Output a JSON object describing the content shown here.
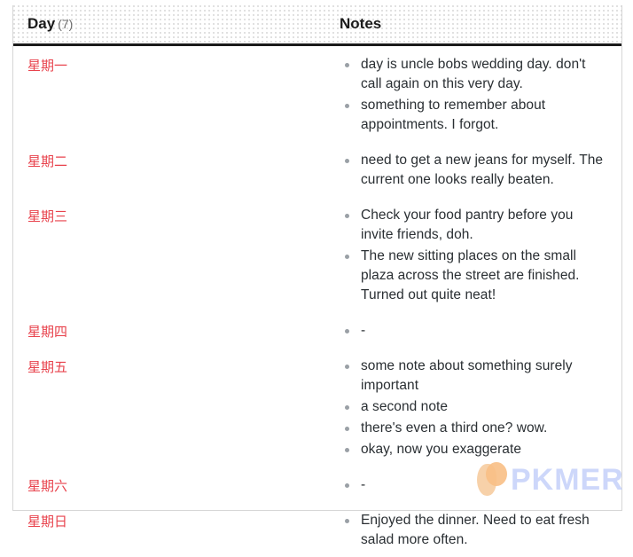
{
  "table": {
    "columns": [
      {
        "key": "day",
        "label": "Day",
        "count": "(7)"
      },
      {
        "key": "notes",
        "label": "Notes"
      }
    ],
    "rows": [
      {
        "day": "星期一",
        "notes": [
          "day is uncle bobs wedding day. don't call again on this very day.",
          "something to remember about appointments. I forgot."
        ]
      },
      {
        "day": "星期二",
        "notes": [
          "need to get a new jeans for myself. The current one looks really beaten."
        ]
      },
      {
        "day": "星期三",
        "notes": [
          "Check your food pantry before you invite friends, doh.",
          "The new sitting places on the small plaza across the street are finished. Turned out quite neat!"
        ]
      },
      {
        "day": "星期四",
        "notes": [
          "-"
        ]
      },
      {
        "day": "星期五",
        "notes": [
          "some note about something surely important",
          "a second note",
          "there's even a third one? wow.",
          "okay, now you exaggerate"
        ]
      },
      {
        "day": "星期六",
        "notes": [
          "-"
        ]
      },
      {
        "day": "星期日",
        "notes": [
          "Enjoyed the dinner. Need to eat fresh salad more often."
        ]
      }
    ]
  },
  "watermark": {
    "text": "PKMER",
    "logo_icon": "pkmer-leaf-logo-icon",
    "text_color": "#c3cffa",
    "logo_color": "#f6c08a"
  },
  "colors": {
    "day_text": "#e8434d",
    "note_text": "#2a2f33",
    "header_text": "#1a1a1a",
    "header_count": "#6e6e6e",
    "bullet": "#9aa0a6",
    "header_rule": "#1b1b1b",
    "table_border": "#d6d6d6"
  }
}
